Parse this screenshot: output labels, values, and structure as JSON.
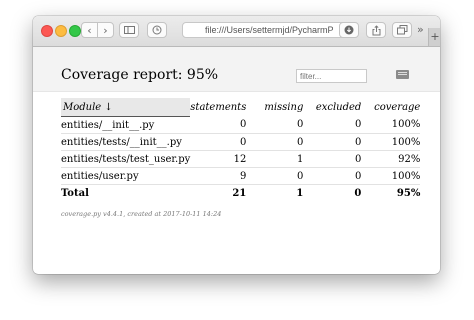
{
  "browser": {
    "url": "file:///Users/settermjd/PycharmP",
    "back_icon": "chevron-left",
    "forward_icon": "chevron-right",
    "more_label": "»",
    "new_tab_label": "+"
  },
  "report": {
    "title": "Coverage report: 95%",
    "filter_placeholder": "filter...",
    "columns": [
      "Module ↓",
      "statements",
      "missing",
      "excluded",
      "coverage"
    ],
    "rows": [
      {
        "module": "entities/__init__.py",
        "statements": "0",
        "missing": "0",
        "excluded": "0",
        "coverage": "100%"
      },
      {
        "module": "entities/tests/__init__.py",
        "statements": "0",
        "missing": "0",
        "excluded": "0",
        "coverage": "100%"
      },
      {
        "module": "entities/tests/test_user.py",
        "statements": "12",
        "missing": "1",
        "excluded": "0",
        "coverage": "92%"
      },
      {
        "module": "entities/user.py",
        "statements": "9",
        "missing": "0",
        "excluded": "0",
        "coverage": "100%"
      }
    ],
    "total": {
      "module": "Total",
      "statements": "21",
      "missing": "1",
      "excluded": "0",
      "coverage": "95%"
    },
    "footer": "coverage.py v4.4.1, created at 2017-10-11 14:24"
  }
}
